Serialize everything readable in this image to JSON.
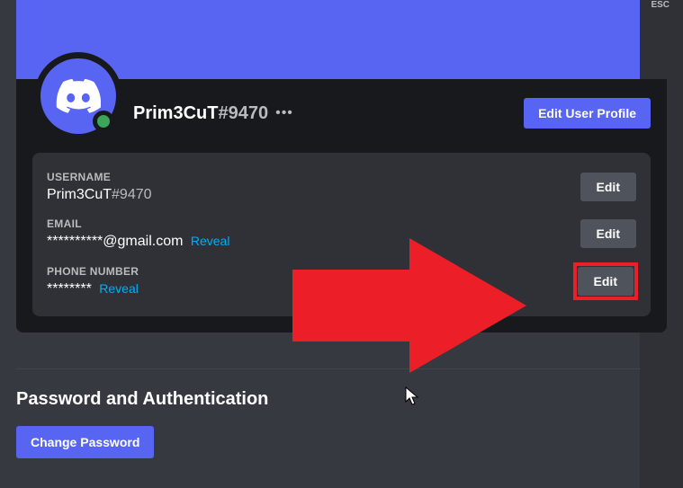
{
  "esc": "ESC",
  "profile": {
    "username": "Prim3CuT",
    "discriminator": "#9470",
    "edit_profile_label": "Edit User Profile"
  },
  "fields": {
    "username_label": "USERNAME",
    "username_value": "Prim3CuT",
    "username_discriminator": "#9470",
    "email_label": "EMAIL",
    "email_value": "**********@gmail.com",
    "email_reveal": "Reveal",
    "phone_label": "PHONE NUMBER",
    "phone_value": "********",
    "phone_reveal": "Reveal",
    "edit_label": "Edit"
  },
  "password_section": {
    "title": "Password and Authentication",
    "change_password_label": "Change Password"
  }
}
